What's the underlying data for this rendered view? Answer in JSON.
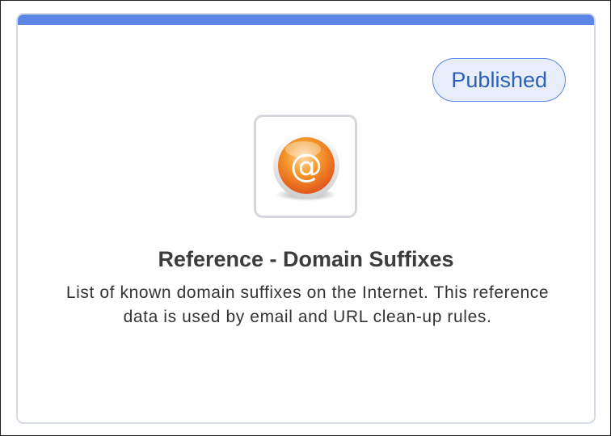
{
  "card": {
    "status": "Published",
    "icon": "at-sign-icon",
    "title": "Reference - Domain Suffixes",
    "description": "List of known domain suffixes on the Internet. This reference data is used by email and URL clean-up rules.",
    "colors": {
      "accent": "#5b86e5",
      "badge_background": "#e8eef9",
      "badge_text": "#2f5fb3",
      "icon_orange": "#f28a1e"
    }
  }
}
